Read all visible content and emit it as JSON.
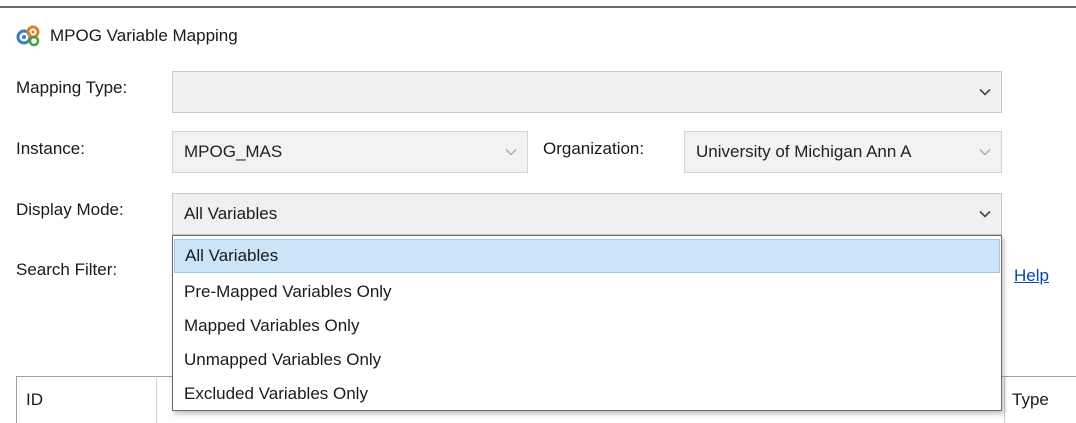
{
  "window": {
    "title": "MPOG Variable Mapping",
    "app_icon": "mpog-variable-mapping-icon"
  },
  "form": {
    "mapping_type": {
      "label": "Mapping Type:",
      "value": ""
    },
    "instance": {
      "label": "Instance:",
      "value": "MPOG_MAS"
    },
    "organization": {
      "label": "Organization:",
      "value": "University of Michigan Ann A"
    },
    "display_mode": {
      "label": "Display Mode:",
      "value": "All Variables",
      "options": [
        "All Variables",
        "Pre-Mapped Variables Only",
        "Mapped Variables Only",
        "Unmapped Variables Only",
        "Excluded Variables Only"
      ],
      "highlighted_option": "All Variables"
    },
    "search_filter": {
      "label": "Search Filter:"
    },
    "help_link": "Help"
  },
  "grid": {
    "columns": [
      {
        "label": "ID"
      },
      {
        "label": "Type"
      }
    ]
  },
  "colors": {
    "highlight": "#cce4f7",
    "link": "#0645ad",
    "combo_bg": "#f0f0f0"
  }
}
